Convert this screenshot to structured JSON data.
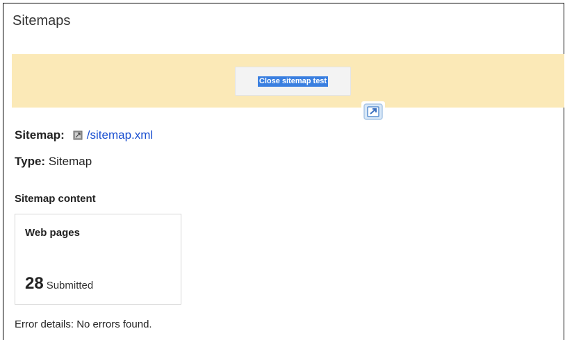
{
  "page": {
    "title": "Sitemaps"
  },
  "banner": {
    "close_button_label": "Close sitemap test",
    "popout_icon": "open-in-new-window-icon"
  },
  "sitemap": {
    "label": "Sitemap:",
    "file_icon": "file-icon",
    "path": "/sitemap.xml"
  },
  "type": {
    "label": "Type:",
    "value": "Sitemap"
  },
  "content": {
    "section_title": "Sitemap content",
    "card_title": "Web pages",
    "count": "28",
    "count_unit": "Submitted"
  },
  "errors": {
    "label": "Error details:",
    "value": "No errors found."
  },
  "colors": {
    "banner_bg": "#fbe9b7",
    "link": "#1a4fd0",
    "selection_highlight": "#3a7fe0"
  }
}
